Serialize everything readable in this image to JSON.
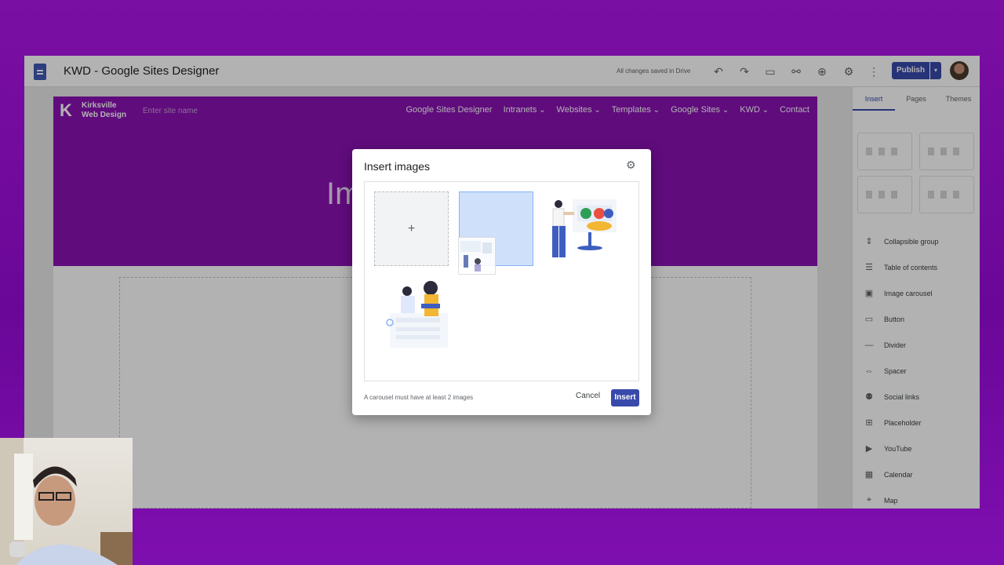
{
  "app": {
    "title": "KWD - Google Sites Designer",
    "save_status": "All changes saved in Drive",
    "publish_label": "Publish",
    "accent": "#3949ab"
  },
  "toolbar_icons": [
    "undo-icon",
    "redo-icon",
    "preview-icon",
    "link-icon",
    "share-icon",
    "settings-icon",
    "more-icon"
  ],
  "site": {
    "logo_line1": "Kirksville",
    "logo_line2": "Web Design",
    "site_name_placeholder": "Enter site name",
    "hero_text": "Im",
    "header_color": "#8a12b4",
    "nav": [
      {
        "label": "Google Sites Designer",
        "dropdown": false
      },
      {
        "label": "Intranets",
        "dropdown": true
      },
      {
        "label": "Websites",
        "dropdown": true
      },
      {
        "label": "Templates",
        "dropdown": true
      },
      {
        "label": "Google Sites",
        "dropdown": true
      },
      {
        "label": "KWD",
        "dropdown": true
      },
      {
        "label": "Contact",
        "dropdown": false
      }
    ]
  },
  "panel": {
    "tabs": [
      "Insert",
      "Pages",
      "Themes"
    ],
    "active_tab": "Insert",
    "items": [
      {
        "label": "Collapsible group",
        "icon": "collapse-icon"
      },
      {
        "label": "Table of contents",
        "icon": "toc-icon"
      },
      {
        "label": "Image carousel",
        "icon": "carousel-icon"
      },
      {
        "label": "Button",
        "icon": "button-icon"
      },
      {
        "label": "Divider",
        "icon": "divider-icon"
      },
      {
        "label": "Spacer",
        "icon": "spacer-icon"
      },
      {
        "label": "Social links",
        "icon": "social-icon"
      },
      {
        "label": "Placeholder",
        "icon": "placeholder-icon"
      },
      {
        "label": "YouTube",
        "icon": "youtube-icon"
      },
      {
        "label": "Calendar",
        "icon": "calendar-icon"
      },
      {
        "label": "Map",
        "icon": "map-icon"
      }
    ]
  },
  "dialog": {
    "title": "Insert images",
    "add_symbol": "+",
    "note": "A carousel must have at least 2 images",
    "cancel_label": "Cancel",
    "insert_label": "Insert"
  }
}
